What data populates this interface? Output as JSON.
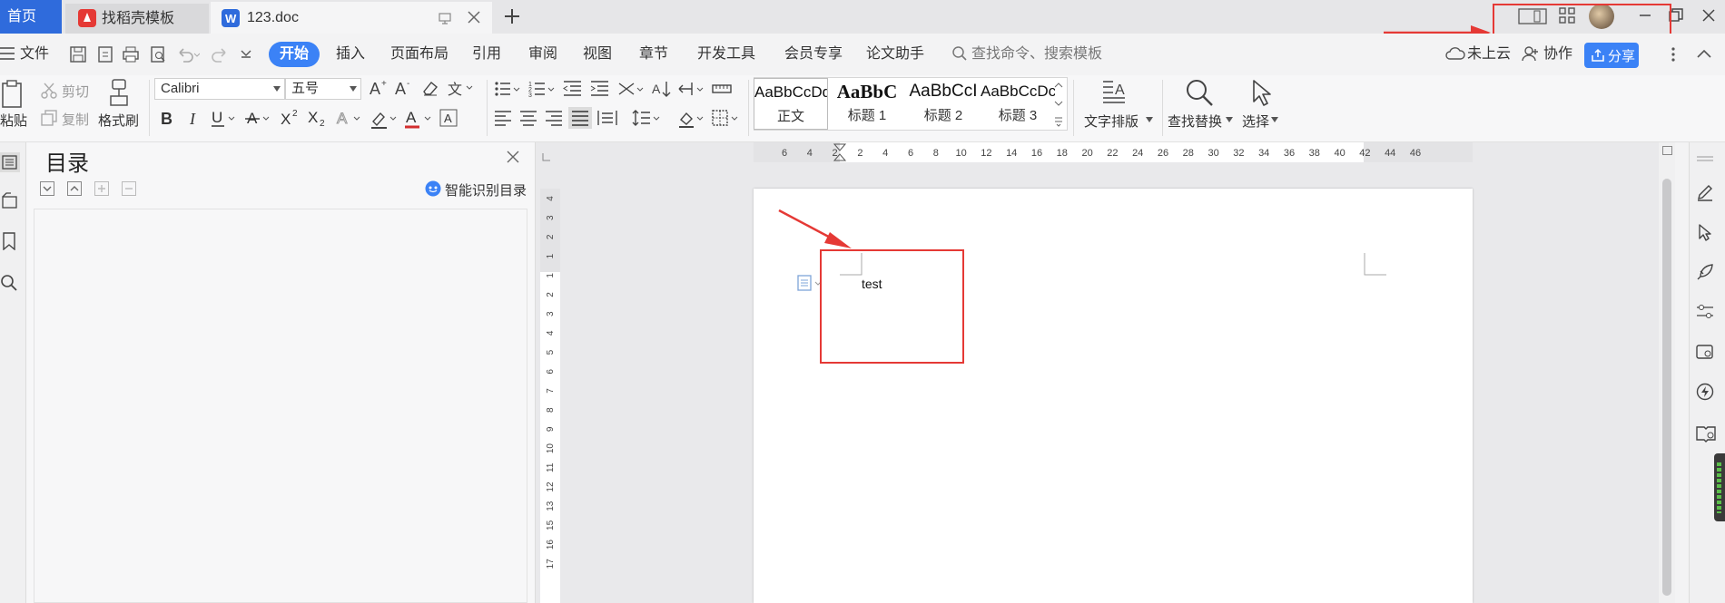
{
  "tabs": {
    "home": "首页",
    "templates": "找稻壳模板",
    "document": "123.doc"
  },
  "menu": {
    "file": "文件",
    "items": [
      "开始",
      "插入",
      "页面布局",
      "引用",
      "审阅",
      "视图",
      "章节",
      "开发工具",
      "会员专享",
      "论文助手"
    ],
    "search_placeholder": "查找命令、搜索模板",
    "cloud": "未上云",
    "collab": "协作",
    "share": "分享"
  },
  "ribbon": {
    "paste": "粘贴",
    "cut": "剪切",
    "copy": "复制",
    "format_painter": "格式刷",
    "font": "Calibri",
    "size": "五号",
    "styles": [
      {
        "sample": "AaBbCcDd",
        "label": "正文"
      },
      {
        "sample": "AaBbC",
        "label": "标题 1"
      },
      {
        "sample": "AaBbCcI",
        "label": "标题 2"
      },
      {
        "sample": "AaBbCcDc",
        "label": "标题 3"
      }
    ],
    "text_layout": "文字排版",
    "find_replace": "查找替换",
    "select": "选择"
  },
  "nav": {
    "title": "目录",
    "smart_toc": "智能识别目录"
  },
  "document": {
    "text": "test"
  },
  "rulers": {
    "h": [
      "6",
      "4",
      "2",
      "2",
      "4",
      "6",
      "8",
      "10",
      "12",
      "14",
      "16",
      "18",
      "20",
      "22",
      "24",
      "26",
      "28",
      "30",
      "32",
      "34",
      "36",
      "38",
      "40",
      "42",
      "44",
      "46"
    ],
    "v": [
      "4",
      "3",
      "2",
      "1",
      "1",
      "2",
      "3",
      "4",
      "5",
      "6",
      "7",
      "8",
      "9",
      "10",
      "11",
      "12",
      "13",
      "15",
      "16",
      "17"
    ]
  },
  "colors": {
    "accent": "#3b82f6",
    "annotation": "#e53935"
  }
}
